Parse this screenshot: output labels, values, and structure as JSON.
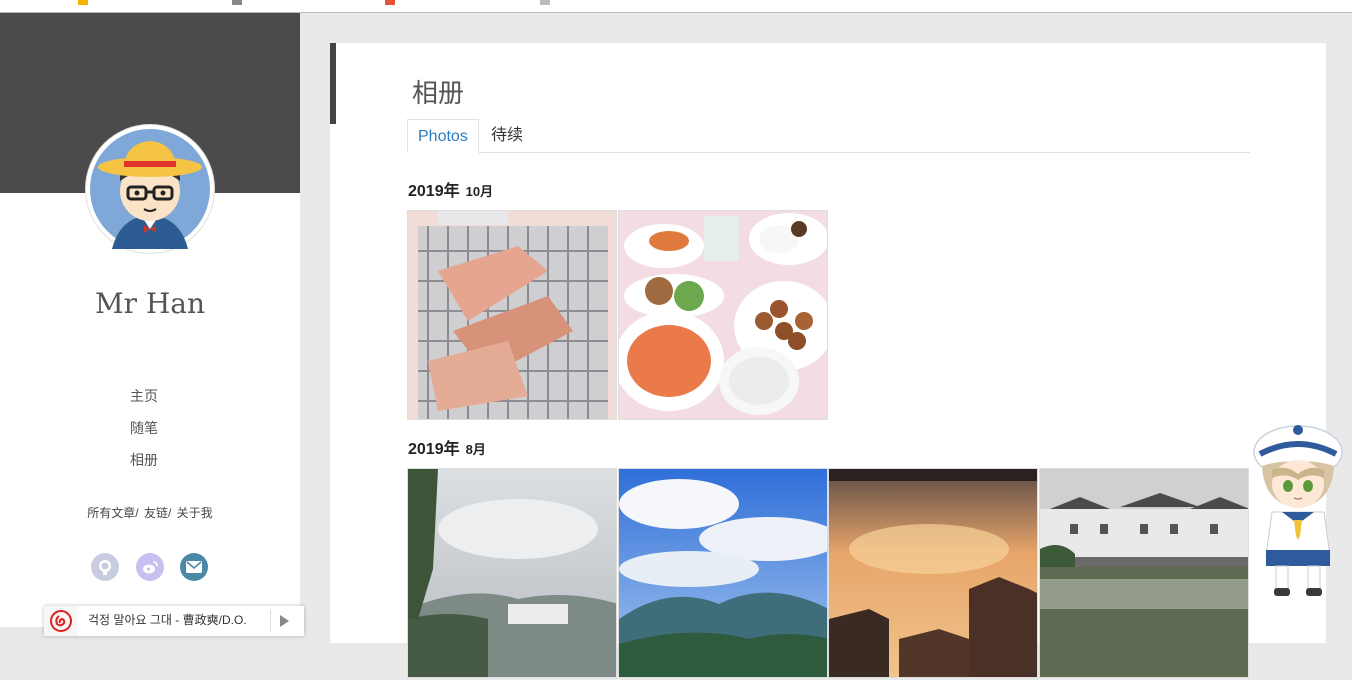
{
  "sidebar": {
    "author_name": "Mr Han",
    "nav": [
      {
        "label": "主页"
      },
      {
        "label": "随笔"
      },
      {
        "label": "相册"
      }
    ],
    "sub_links": [
      "所有文章/",
      "友链/",
      "关于我"
    ],
    "socials": [
      {
        "icon": "github-icon",
        "color": "#c9cbe0"
      },
      {
        "icon": "weibo-icon",
        "color": "#c9c0f2"
      },
      {
        "icon": "mail-icon",
        "color": "#4b88a6"
      }
    ]
  },
  "player": {
    "track": "걱정 말아요 그대 - 曹政奭/D.O."
  },
  "main": {
    "title": "相册",
    "tabs": [
      {
        "label": "Photos",
        "active": true
      },
      {
        "label": "待续",
        "active": false
      }
    ],
    "sections": [
      {
        "year": "2019年",
        "month": "10月",
        "photo_count": 2
      },
      {
        "year": "2019年",
        "month": "8月",
        "photo_count": 4
      }
    ]
  },
  "colors": {
    "accent_blue": "#2b7bbd",
    "cover_dark": "#4b4b4b",
    "player_red": "#e02020"
  }
}
